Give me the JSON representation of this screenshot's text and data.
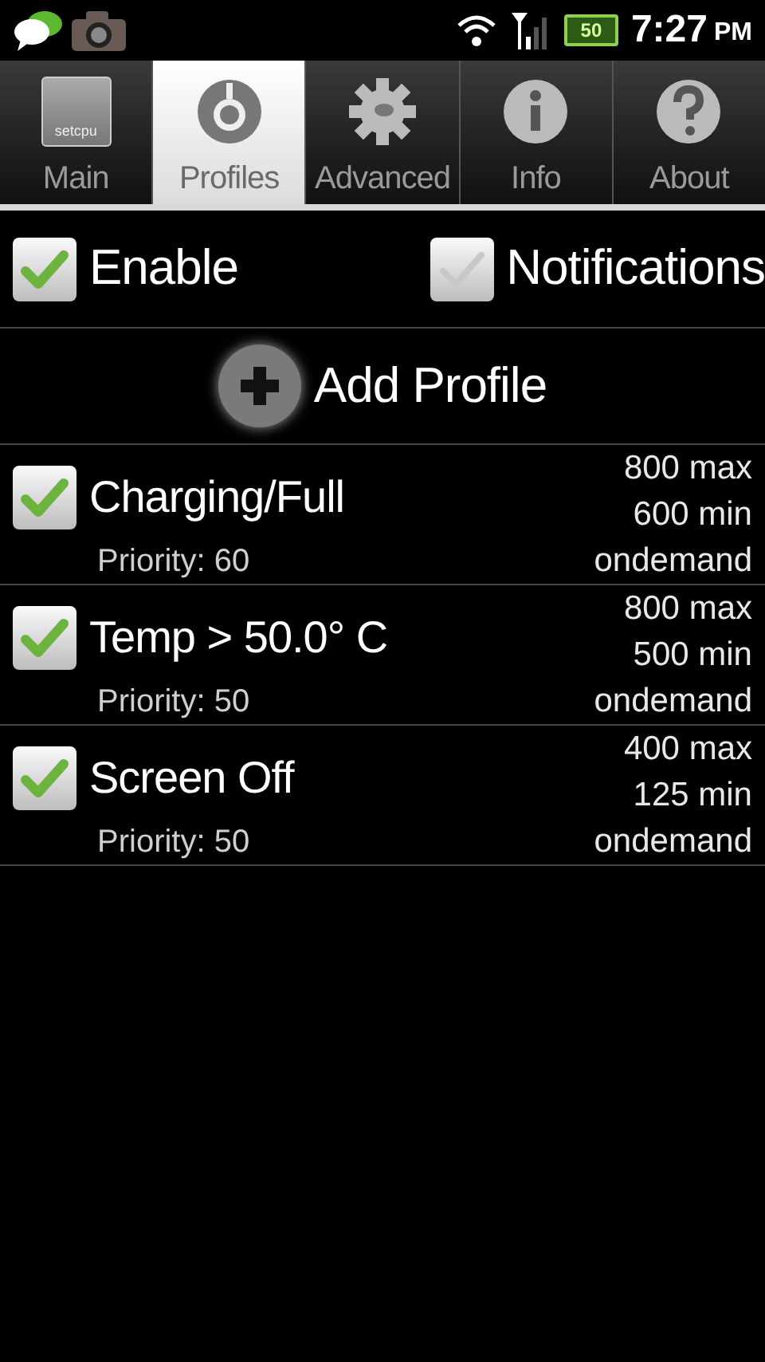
{
  "status_bar": {
    "battery": "50",
    "time": "7:27",
    "meridiem": "PM"
  },
  "tabs": [
    {
      "label": "Main",
      "kind": "logo",
      "logo_text": "setcpu",
      "selected": false
    },
    {
      "label": "Profiles",
      "kind": "dial",
      "selected": true
    },
    {
      "label": "Advanced",
      "kind": "gear",
      "selected": false
    },
    {
      "label": "Info",
      "kind": "info",
      "selected": false
    },
    {
      "label": "About",
      "kind": "help",
      "selected": false
    }
  ],
  "options": [
    {
      "label": "Enable",
      "checked": true
    },
    {
      "label": "Notifications",
      "checked": false
    }
  ],
  "add_profile": {
    "label": "Add Profile"
  },
  "profiles": [
    {
      "name": "Charging/Full",
      "priority": "Priority: 60",
      "max": "800 max",
      "min": "600 min",
      "governor": "ondemand",
      "checked": true
    },
    {
      "name": "Temp > 50.0° C",
      "priority": "Priority: 50",
      "max": "800 max",
      "min": "500 min",
      "governor": "ondemand",
      "checked": true
    },
    {
      "name": "Screen Off",
      "priority": "Priority: 50",
      "max": "400 max",
      "min": "125 min",
      "governor": "ondemand",
      "checked": true
    }
  ]
}
